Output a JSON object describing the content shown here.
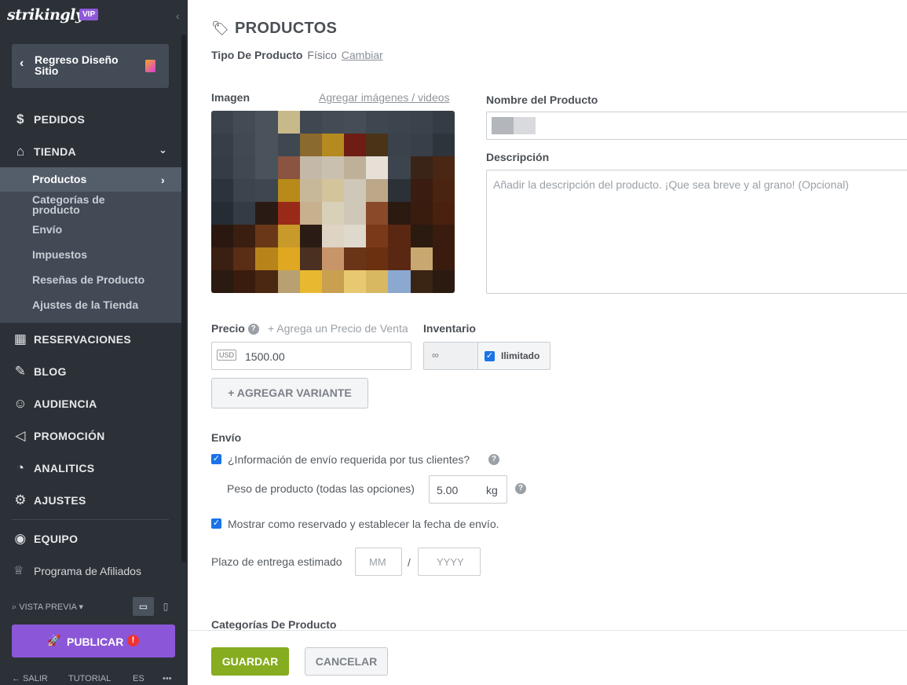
{
  "sidebar": {
    "logo": "strikingly",
    "vip_badge": "VIP",
    "back_label": "Regreso Diseño Sitio",
    "nav": {
      "pedidos": "PEDIDOS",
      "tienda": "TIENDA",
      "reservaciones": "RESERVACIONES",
      "blog": "BLOG",
      "audiencia": "AUDIENCIA",
      "promocion": "PROMOCIÓN",
      "analitics": "ANALITICS",
      "ajustes": "AJUSTES",
      "equipo": "EQUIPO"
    },
    "store_submenu": {
      "productos": "Productos",
      "categorias": "Categorías de producto",
      "envio": "Envío",
      "impuestos": "Impuestos",
      "resenas": "Reseñas de Producto",
      "ajustes_tienda": "Ajustes de la Tienda"
    },
    "affiliate": "Programa de Afiliados",
    "preview": "VISTA PREVIA",
    "publish": "PUBLICAR",
    "bottom": {
      "exit": "SALIR",
      "tutorial": "TUTORIAL",
      "lang": "ES",
      "more": "•••"
    }
  },
  "main": {
    "title": "PRODUCTOS",
    "product_type_label": "Tipo De Producto",
    "product_type_value": "Físico",
    "change_link": "Cambiar",
    "image_label": "Imagen",
    "add_media_link": "Agregar imágenes / videos",
    "name_label": "Nombre del Producto",
    "description_label": "Descripción",
    "description_placeholder": "Añadir la descripción del producto. ¡Que sea breve y al grano! (Opcional)",
    "price_label": "Precio",
    "add_sale_price": "+ Agrega un Precio de Venta",
    "currency": "USD",
    "price_value": "1500.00",
    "inventory_label": "Inventario",
    "inventory_value": "∞",
    "unlimited_label": "Ilimitado",
    "add_variant": "AGREGAR VARIANTE",
    "shipping_label": "Envío",
    "shipping_required": "¿Información de envío requerida por tus clientes?",
    "weight_label": "Peso de producto (todas las opciones)",
    "weight_value": "5.00",
    "weight_unit": "kg",
    "reserved_label": "Mostrar como reservado y establecer la fecha de envío.",
    "delivery_label": "Plazo de entrega estimado",
    "month_placeholder": "MM",
    "separator": "/",
    "year_placeholder": "YYYY",
    "categories_label": "Categorías De Producto",
    "save": "GUARDAR",
    "cancel": "CANCELAR"
  },
  "colors": {
    "sidebar_bg": "#2c3138",
    "publish": "#8b57d8",
    "save": "#86ac1f",
    "checkbox": "#1a73e8"
  }
}
